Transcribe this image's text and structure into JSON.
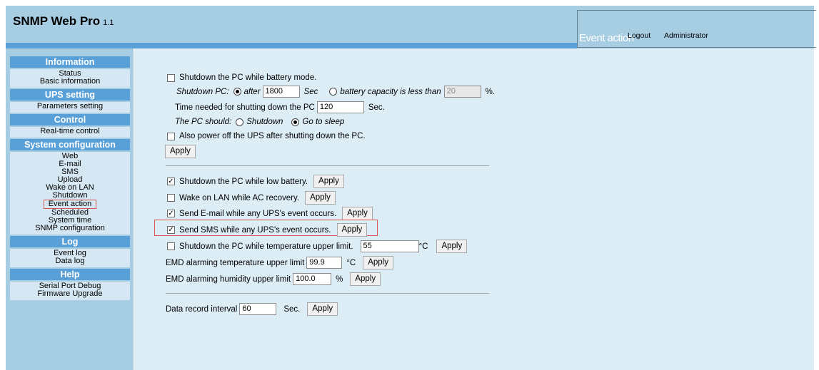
{
  "header": {
    "title": "SNMP Web Pro",
    "version": "1.1",
    "current_page": "Event action",
    "logout": "Logout",
    "user": "Administrator"
  },
  "menu": [
    {
      "title": "Information",
      "items": [
        "Status",
        "Basic information"
      ]
    },
    {
      "title": "UPS setting",
      "items": [
        "Parameters setting"
      ]
    },
    {
      "title": "Control",
      "items": [
        "Real-time control"
      ]
    },
    {
      "title": "System configuration",
      "items": [
        "Web",
        "E-mail",
        "SMS",
        "Upload",
        "Wake on LAN",
        "Shutdown",
        "Event action",
        "Scheduled",
        "System time",
        "SNMP configuration"
      ]
    },
    {
      "title": "Log",
      "items": [
        "Event log",
        "Data log"
      ]
    },
    {
      "title": "Help",
      "items": [
        "Serial Port Debug",
        "Firmware Upgrade"
      ]
    }
  ],
  "shutdown": {
    "label": "Shutdown the PC while battery mode.",
    "checked": false,
    "shutdown_pc_label": "Shutdown PC:",
    "after_label": "after",
    "after_value": "1800",
    "sec_label": "Sec",
    "capacity_label": "battery capacity is less than",
    "capacity_value": "20",
    "percent": "%.",
    "time_needed_label": "Time needed for shutting down the PC",
    "time_needed_value": "120",
    "time_unit": "Sec.",
    "pc_should_label": "The PC should:",
    "opt_shutdown": "Shutdown",
    "opt_sleep": "Go to sleep",
    "power_off_label": "Also power off the UPS after shutting down the PC.",
    "apply": "Apply"
  },
  "events": {
    "low_battery": {
      "label": "Shutdown the PC while low battery.",
      "checked": true
    },
    "wol": {
      "label": "Wake on LAN while AC recovery.",
      "checked": false
    },
    "email": {
      "label": "Send E-mail while any UPS's event occurs.",
      "checked": true
    },
    "sms": {
      "label": "Send SMS while any UPS's event occurs.",
      "checked": true
    },
    "temp": {
      "label": "Shutdown the PC while temperature upper limit.",
      "checked": false,
      "value": "55",
      "unit": "°C"
    },
    "emd_temp": {
      "label": "EMD alarming temperature upper limit",
      "value": "99.9",
      "unit": "°C"
    },
    "emd_hum": {
      "label": "EMD alarming humidity upper limit",
      "value": "100.0",
      "unit": "%"
    },
    "apply": "Apply",
    "check_mark": "✓"
  },
  "record": {
    "label": "Data record interval",
    "value": "60",
    "unit": "Sec.",
    "apply": "Apply"
  }
}
